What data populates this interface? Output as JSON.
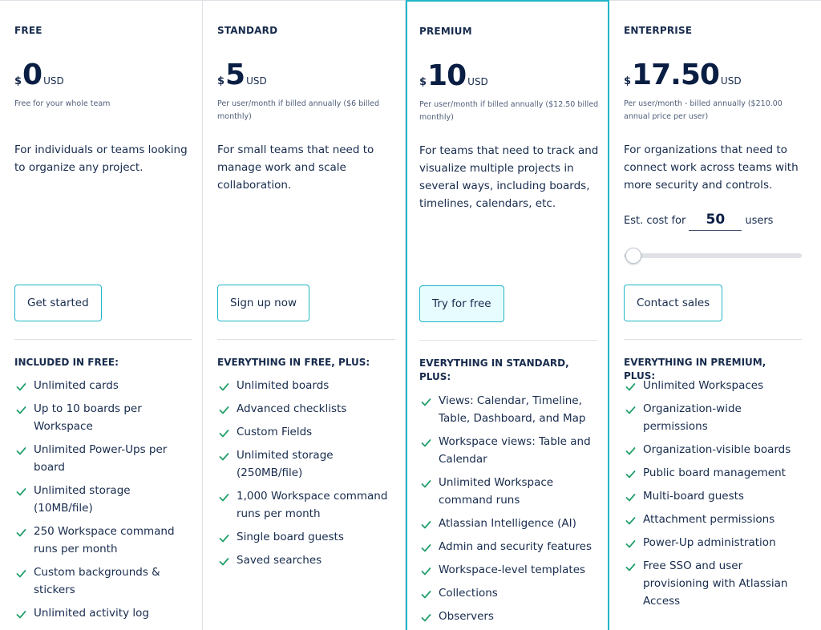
{
  "plans": [
    {
      "name": "FREE",
      "currency": "$",
      "amount": "0",
      "unit": "USD",
      "price_note": "Free for your whole team",
      "description": "For individuals or teams looking to organize any project.",
      "cta": "Get started",
      "features_title": "INCLUDED IN FREE:",
      "features": [
        "Unlimited cards",
        "Up to 10 boards per Workspace",
        "Unlimited Power-Ups per board",
        "Unlimited storage (10MB/file)",
        "250 Workspace command runs per month",
        "Custom backgrounds & stickers",
        "Unlimited activity log"
      ]
    },
    {
      "name": "STANDARD",
      "currency": "$",
      "amount": "5",
      "unit": "USD",
      "price_note": "Per user/month if billed annually ($6 billed monthly)",
      "description": "For small teams that need to manage work and scale collaboration.",
      "cta": "Sign up now",
      "features_title": "EVERYTHING IN FREE, PLUS:",
      "features": [
        "Unlimited boards",
        "Advanced checklists",
        "Custom Fields",
        "Unlimited storage (250MB/file)",
        "1,000 Workspace command runs per month",
        "Single board guests",
        "Saved searches"
      ]
    },
    {
      "name": "PREMIUM",
      "currency": "$",
      "amount": "10",
      "unit": "USD",
      "price_note": "Per user/month if billed annually ($12.50 billed monthly)",
      "description": "For teams that need to track and visualize multiple projects in several ways, including boards, timelines, calendars, etc.",
      "cta": "Try for free",
      "features_title": "EVERYTHING IN STANDARD, PLUS:",
      "features": [
        "Views: Calendar, Timeline, Table, Dashboard, and Map",
        "Workspace views: Table and Calendar",
        "Unlimited Workspace command runs",
        "Atlassian Intelligence (AI)",
        "Admin and security features",
        "Workspace-level templates",
        "Collections",
        "Observers"
      ]
    },
    {
      "name": "ENTERPRISE",
      "currency": "$",
      "amount": "17.50",
      "unit": "USD",
      "price_note": "Per user/month - billed annually ($210.00 annual price per user)",
      "description": "For organizations that need to connect work across teams with more security and controls.",
      "estimate": {
        "prefix": "Est. cost for",
        "value": "50",
        "suffix": "users",
        "slider_fraction": 0
      },
      "cta": "Contact sales",
      "features_title": "EVERYTHING IN PREMIUM, PLUS:",
      "features": [
        "Unlimited Workspaces",
        "Organization-wide permissions",
        "Organization-visible boards",
        "Public board management",
        "Multi-board guests",
        "Attachment permissions",
        "Power-Up administration",
        "Free SSO and user provisioning with Atlassian Access"
      ]
    }
  ],
  "icons": {
    "feature_check": "check-icon"
  },
  "colors": {
    "accent": "#1fb6c7",
    "check": "#22a06b",
    "text": "#172b4d",
    "muted": "#505f79",
    "divider": "#dfe1e6",
    "premium_button_fill": "#e6fcff"
  }
}
